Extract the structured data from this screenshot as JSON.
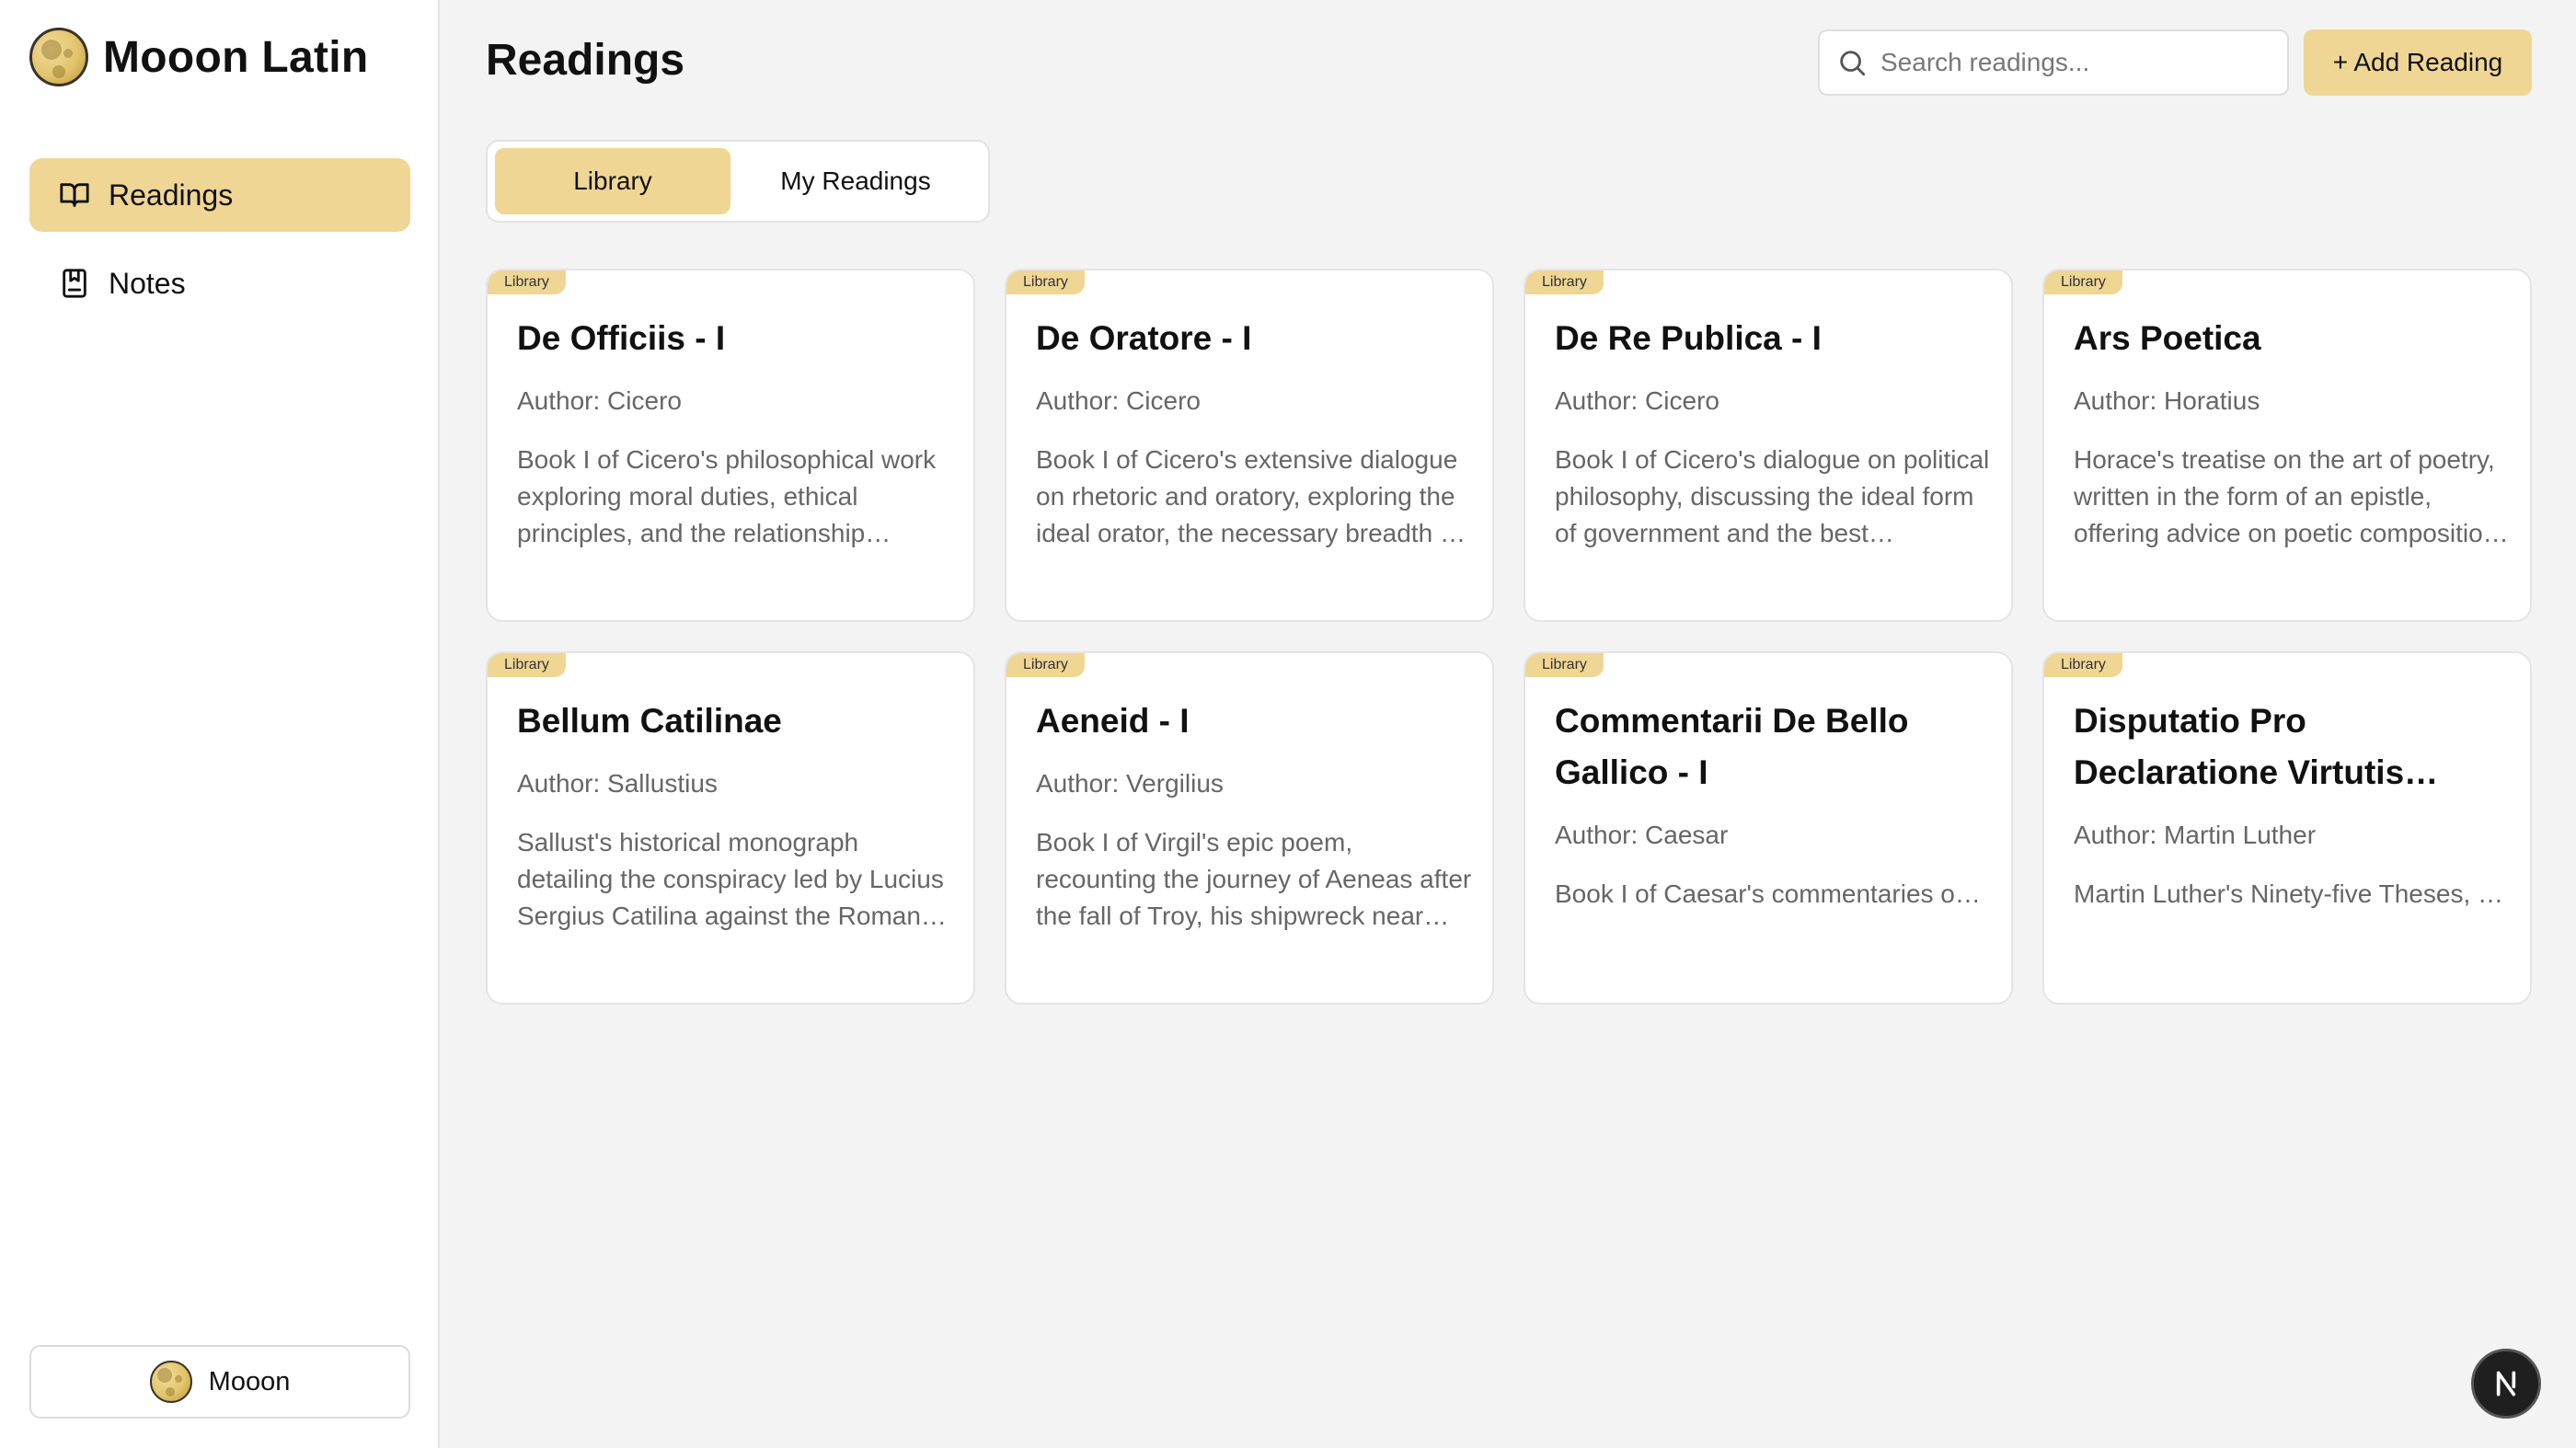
{
  "app": {
    "title": "Mooon Latin"
  },
  "sidebar": {
    "items": [
      {
        "label": "Readings",
        "icon": "book-open-icon",
        "active": true
      },
      {
        "label": "Notes",
        "icon": "notebook-icon",
        "active": false
      }
    ],
    "user": {
      "name": "Mooon"
    }
  },
  "header": {
    "title": "Readings",
    "search_placeholder": "Search readings...",
    "add_label": "+ Add Reading"
  },
  "tabs": [
    {
      "label": "Library",
      "active": true
    },
    {
      "label": "My Readings",
      "active": false
    }
  ],
  "cards": [
    {
      "badge": "Library",
      "title": "De Officiis - I",
      "author": "Author: Cicero",
      "description": "Book I of Cicero's philosophical work exploring moral duties, ethical principles, and the relationship between what is honorable and what is useful."
    },
    {
      "badge": "Library",
      "title": "De Oratore - I",
      "author": "Author: Cicero",
      "description": "Book I of Cicero's extensive dialogue on rhetoric and oratory, exploring the ideal orator, the necessary breadth of knowledge and training."
    },
    {
      "badge": "Library",
      "title": "De Re Publica - I",
      "author": "Author: Cicero",
      "description": "Book I of Cicero's dialogue on political philosophy, discussing the ideal form of government and the best constitution of the state."
    },
    {
      "badge": "Library",
      "title": "Ars Poetica",
      "author": "Author: Horatius",
      "description": "Horace's treatise on the art of poetry, written in the form of an epistle, offering advice on poetic composition and dramatic craft."
    },
    {
      "badge": "Library",
      "title": "Bellum Catilinae",
      "author": "Author: Sallustius",
      "description": "Sallust's historical monograph detailing the conspiracy led by Lucius Sergius Catilina against the Roman Republic."
    },
    {
      "badge": "Library",
      "title": "Aeneid - I",
      "author": "Author: Vergilius",
      "description": "Book I of Virgil's epic poem, recounting the journey of Aeneas after the fall of Troy, his shipwreck near Carthage and meeting with Dido."
    },
    {
      "badge": "Library",
      "title": "Commentarii De Bello Gallico - I",
      "author": "Author: Caesar",
      "description": "Book I of Caesar's commentaries on the Gallic War."
    },
    {
      "badge": "Library",
      "title": "Disputatio Pro Declaratione Virtutis Indulgentiarum",
      "author": "Author: Martin Luther",
      "description": "Martin Luther's Ninety-five Theses, a disputation on the power of indulgences."
    }
  ],
  "colors": {
    "accent": "#efd694",
    "background": "#f3f3f3"
  }
}
